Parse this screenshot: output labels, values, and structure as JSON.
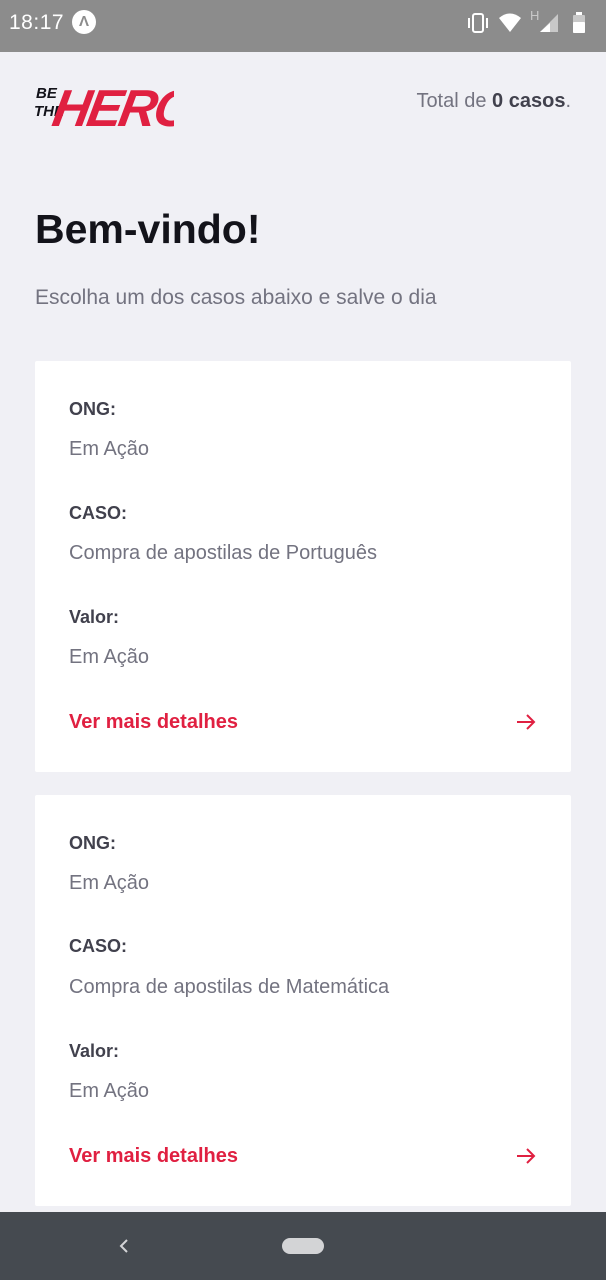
{
  "status_bar": {
    "time": "18:17",
    "app_icon_glyph": "Λ",
    "icons": [
      "vibrate-icon",
      "wifi-icon",
      "signal-icon",
      "battery-icon"
    ],
    "network_label": "H"
  },
  "header": {
    "logo_text_small_1": "BE",
    "logo_text_small_2": "THE",
    "logo_text_big": "HERO",
    "total_prefix": "Total de ",
    "total_count": "0 casos",
    "total_suffix": "."
  },
  "page": {
    "title": "Bem-vindo!",
    "subtitle": "Escolha um dos casos abaixo e salve o dia"
  },
  "incidents": [
    {
      "ong_label": "ONG:",
      "ong_value": "Em Ação",
      "case_label": "CASO:",
      "case_value": "Compra de apostilas de Português",
      "value_label": "Valor:",
      "value_value": "Em Ação",
      "details_label": "Ver mais detalhes"
    },
    {
      "ong_label": "ONG:",
      "ong_value": "Em Ação",
      "case_label": "CASO:",
      "case_value": "Compra de apostilas de Matemática",
      "value_label": "Valor:",
      "value_value": "Em Ação",
      "details_label": "Ver mais detalhes"
    }
  ],
  "colors": {
    "brand_red": "#e02041",
    "background": "#f0f0f5",
    "text_dark": "#41414d",
    "text_muted": "#737380"
  }
}
